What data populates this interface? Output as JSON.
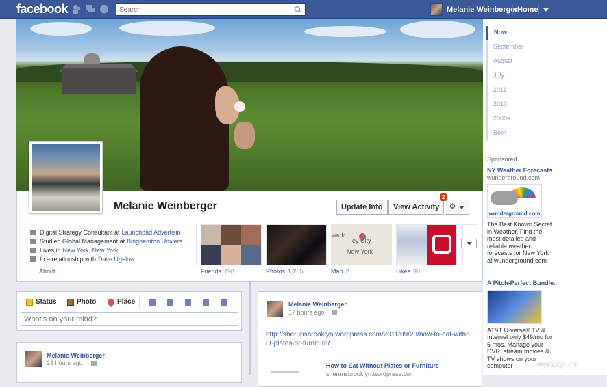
{
  "topbar": {
    "logo": "facebook",
    "search_placeholder": "Search",
    "user_name": "Melanie Weinberger",
    "home_label": "Home"
  },
  "profile": {
    "name": "Melanie Weinberger",
    "update_info_label": "Update Info",
    "view_activity_label": "View Activity",
    "notification_count": "2",
    "about_items": [
      {
        "text": "Digital Strategy Consultant at ",
        "link": "Launchpad Advertisin"
      },
      {
        "text": "Studied Global Management at ",
        "link": "Binghamton Univers"
      },
      {
        "text": "Lives in ",
        "link": "New York, New York"
      },
      {
        "text": "In a relationship with ",
        "link": "Dave Ugelow"
      }
    ],
    "about_label": "About",
    "tiles": [
      {
        "label": "Friends",
        "count": "798"
      },
      {
        "label": "Photos",
        "count": "1,265"
      },
      {
        "label": "Map",
        "count": "2"
      },
      {
        "label": "Likes",
        "count": "90"
      }
    ],
    "map_text": [
      "ey City",
      "New York",
      "wark"
    ]
  },
  "timeline_nav": [
    "Now",
    "September",
    "August",
    "July",
    "2011",
    "2010",
    "2000s",
    "Born"
  ],
  "sponsored": {
    "heading": "Sponsored",
    "ads": [
      {
        "title": "NY Weather Forecasts",
        "domain": "wunderground.com",
        "image_caption": "wunderground.com",
        "body": "The Best Known Secret in Weather. Find the most detailed and reliable weather forecasts for New York at wunderground.com"
      },
      {
        "title": "A Pitch-Perfect Bundle.",
        "body": "AT&T U-verse® TV & Internet only $49/mo for 6 mos. Manage your DVR, stream movies & TV shows on your computer"
      }
    ]
  },
  "composer": {
    "tabs": [
      "Status",
      "Photo",
      "Place"
    ],
    "placeholder": "What's on your mind?"
  },
  "posts": [
    {
      "author": "Melanie Weinberger",
      "time": "17 hours ago",
      "link": "http://sherunsbrooklyn.wordpress.com/2011/09/23/how-to-eat-without-plates-or-furniture/",
      "preview_title": "How to Eat Without Plates or Furniture",
      "preview_domain": "sherunsbrooklyn.wordpress.com"
    },
    {
      "author": "Melanie Weinberger",
      "time": "23 hours ago"
    }
  ],
  "watermark": "mycity.rs",
  "colors": {
    "brand": "#3b5998",
    "notification": "#dd3c10",
    "background": "#e9ebf1"
  }
}
